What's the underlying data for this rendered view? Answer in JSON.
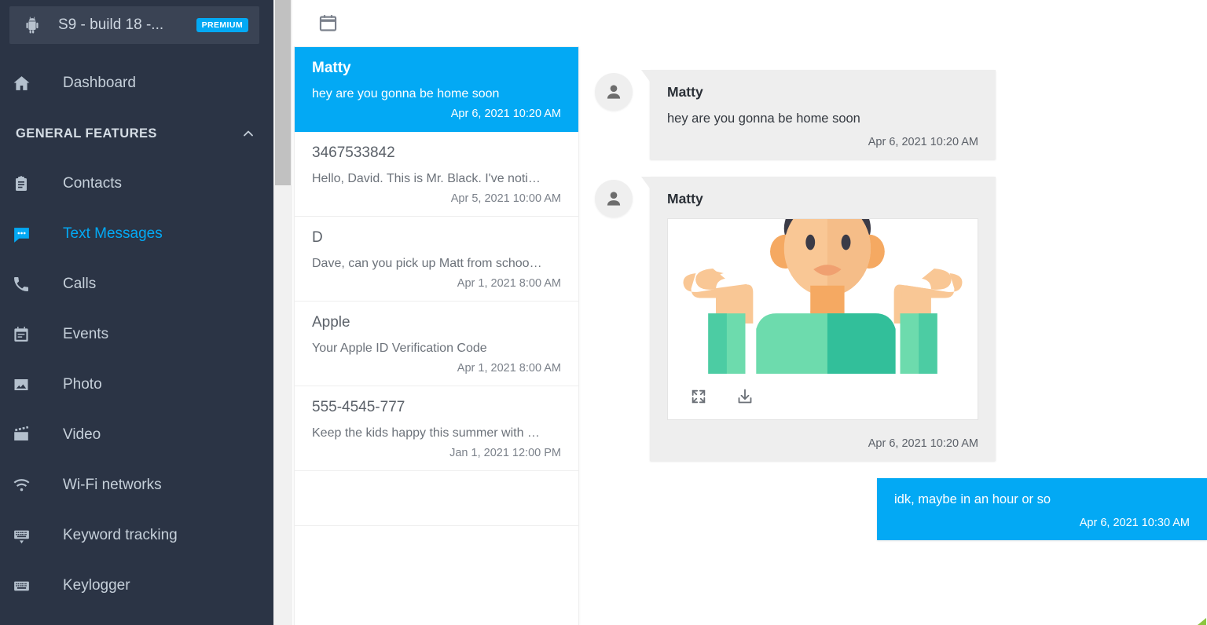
{
  "sidebar": {
    "device": {
      "icon": "android-icon",
      "title": "S9 - build 18 -...",
      "badge": "PREMIUM"
    },
    "dashboard": {
      "label": "Dashboard",
      "icon": "home-icon"
    },
    "section": {
      "label": "GENERAL FEATURES",
      "icon": "chevron-up-icon"
    },
    "items": [
      {
        "label": "Contacts",
        "icon": "contacts-icon",
        "active": false
      },
      {
        "label": "Text Messages",
        "icon": "message-icon",
        "active": true
      },
      {
        "label": "Calls",
        "icon": "phone-icon",
        "active": false
      },
      {
        "label": "Events",
        "icon": "calendar-icon",
        "active": false
      },
      {
        "label": "Photo",
        "icon": "image-icon",
        "active": false
      },
      {
        "label": "Video",
        "icon": "video-icon",
        "active": false
      },
      {
        "label": "Wi-Fi networks",
        "icon": "wifi-icon",
        "active": false
      },
      {
        "label": "Keyword tracking",
        "icon": "keyboard-down-icon",
        "active": false
      },
      {
        "label": "Keylogger",
        "icon": "keyboard-icon",
        "active": false
      }
    ]
  },
  "topbar": {
    "calendar_button": "calendar-icon"
  },
  "conversations": [
    {
      "name": "Matty",
      "snippet": "hey are you gonna be home soon",
      "date": "Apr 6, 2021 10:20 AM",
      "selected": true
    },
    {
      "name": "3467533842",
      "snippet": "Hello, David. This is Mr. Black. I've noti…",
      "date": "Apr 5, 2021 10:00 AM",
      "selected": false
    },
    {
      "name": "D",
      "snippet": "Dave, can you pick up Matt from schoo…",
      "date": "Apr 1, 2021 8:00 AM",
      "selected": false
    },
    {
      "name": "Apple",
      "snippet": "Your Apple ID Verification Code",
      "date": "Apr 1, 2021 8:00 AM",
      "selected": false
    },
    {
      "name": "555-4545-777",
      "snippet": "Keep the kids happy this summer with …",
      "date": "Jan 1, 2021 12:00 PM",
      "selected": false
    }
  ],
  "thread": [
    {
      "direction": "in",
      "sender": "Matty",
      "text": "hey are you gonna be home soon",
      "date": "Apr 6, 2021 10:20 AM",
      "attachment": null
    },
    {
      "direction": "in",
      "sender": "Matty",
      "text": null,
      "date": "Apr 6, 2021 10:20 AM",
      "attachment": {
        "type": "image",
        "alt": "shrugging-person-illustration",
        "expand_label": "fullscreen-icon",
        "download_label": "download-icon"
      }
    },
    {
      "direction": "out",
      "sender": null,
      "text": "idk, maybe in an hour or so",
      "date": "Apr 6, 2021 10:30 AM",
      "attachment": null
    }
  ],
  "colors": {
    "accent": "#03a9f4",
    "sidebar_bg": "#2b3445",
    "sidebar_item_bg": "#3a4354",
    "bubble_in": "#eeeeee",
    "skin": "#f9c795",
    "skin_dark": "#f5a962",
    "hair": "#3b3b47",
    "shirt": "#6ddbad",
    "shirt_dark": "#32bf9a"
  }
}
